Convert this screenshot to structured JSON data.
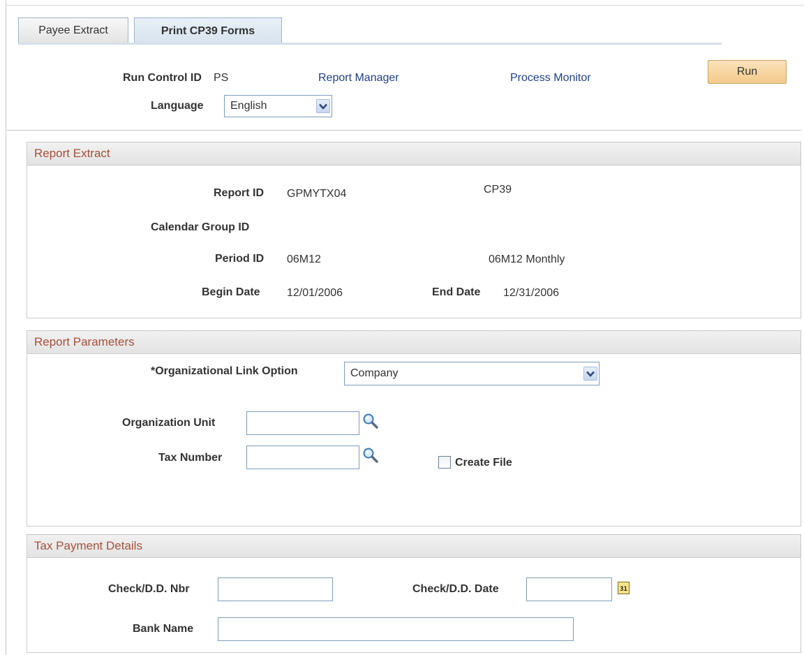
{
  "tabs": [
    {
      "label": "Payee Extract"
    },
    {
      "label": "Print CP39 Forms"
    }
  ],
  "header": {
    "run_control_label": "Run Control ID",
    "run_control_value": "PS",
    "report_manager_link": "Report Manager",
    "process_monitor_link": "Process Monitor",
    "run_button": "Run",
    "language_label": "Language",
    "language_value": "English"
  },
  "report_extract": {
    "title": "Report Extract",
    "report_id_label": "Report ID",
    "report_id_value": "GPMYTX04",
    "report_desc": "CP39",
    "calendar_group_label": "Calendar Group ID",
    "period_id_label": "Period ID",
    "period_id_value": "06M12",
    "period_desc": "06M12 Monthly",
    "begin_date_label": "Begin Date",
    "begin_date_value": "12/01/2006",
    "end_date_label": "End Date",
    "end_date_value": "12/31/2006"
  },
  "report_parameters": {
    "title": "Report Parameters",
    "org_link_label": "*Organizational Link Option",
    "org_link_value": "Company",
    "org_unit_label": "Organization Unit",
    "org_unit_value": "",
    "tax_number_label": "Tax Number",
    "tax_number_value": "",
    "create_file_label": "Create File",
    "create_file_checked": false
  },
  "tax_payment": {
    "title": "Tax Payment Details",
    "check_nbr_label": "Check/D.D. Nbr",
    "check_nbr_value": "",
    "check_date_label": "Check/D.D. Date",
    "check_date_value": "",
    "calendar_icon_text": "31",
    "bank_name_label": "Bank Name",
    "bank_name_value": ""
  },
  "icons": {
    "lookup": "magnifier-icon",
    "calendar": "calendar-icon",
    "dropdown": "chevron-down-icon"
  },
  "colors": {
    "section_title": "#a6503a",
    "link": "#1f3f8c",
    "run_button": "#f3c98b",
    "tab_active": "#d6e3ef"
  }
}
